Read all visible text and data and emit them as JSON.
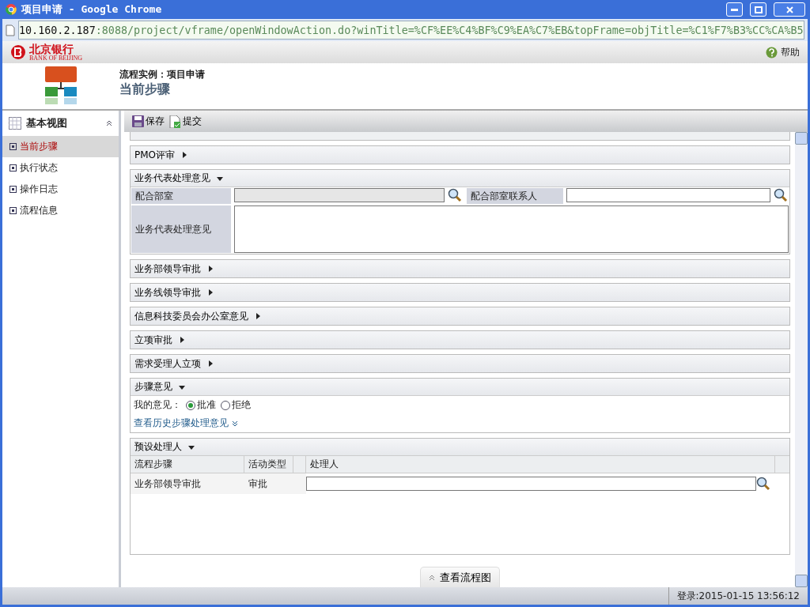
{
  "window": {
    "title": "项目申请 - Google Chrome",
    "url_host": "10.160.2.187",
    "url_rest": ":8088/project/vframe/openWindowAction.do?winTitle=%CF%EE%C4%BF%C9%EA%C7%EB&topFrame=objTitle=%C1%F7%B3%CC%CA%B5"
  },
  "header": {
    "logo_cn": "北京银行",
    "logo_en": "BANK OF BEIJING",
    "help": "帮助",
    "process": "流程实例：项目申请",
    "step": "当前步骤"
  },
  "sidebar": {
    "title": "基本视图",
    "items": [
      {
        "label": "当前步骤",
        "selected": true
      },
      {
        "label": "执行状态",
        "selected": false
      },
      {
        "label": "操作日志",
        "selected": false
      },
      {
        "label": "流程信息",
        "selected": false
      }
    ]
  },
  "toolbar": [
    {
      "label": "保存",
      "kind": "save"
    },
    {
      "label": "提交",
      "kind": "submit"
    }
  ],
  "sections": [
    {
      "kind": "cut"
    },
    {
      "kind": "header",
      "title": "PMO评审",
      "expanded": false
    },
    {
      "kind": "form",
      "title": "业务代表处理意见",
      "expanded": true,
      "dept_label": "配合部室",
      "contact_label": "配合部室联系人",
      "opinion_label": "业务代表处理意见"
    },
    {
      "kind": "header",
      "title": "业务部领导审批",
      "expanded": false
    },
    {
      "kind": "header",
      "title": "业务线领导审批",
      "expanded": false
    },
    {
      "kind": "header",
      "title": "信息科技委员会办公室意见",
      "expanded": false
    },
    {
      "kind": "header",
      "title": "立项审批",
      "expanded": false
    },
    {
      "kind": "header",
      "title": "需求受理人立项",
      "expanded": false
    },
    {
      "kind": "opinion",
      "title": "步骤意见",
      "expanded": true,
      "label": "我的意见：",
      "options": [
        {
          "label": "批准",
          "selected": true
        },
        {
          "label": "拒绝",
          "selected": false
        }
      ],
      "history_link": "查看历史步骤处理意见"
    },
    {
      "kind": "assignees",
      "title": "预设处理人",
      "expanded": true,
      "columns": [
        "流程步骤",
        "活动类型",
        "处理人"
      ],
      "rows": [
        {
          "step": "业务部领导审批",
          "type": "审批"
        }
      ]
    }
  ],
  "flow_button": "查看流程图",
  "status_bar": "登录:2015-01-15 13:56:12"
}
